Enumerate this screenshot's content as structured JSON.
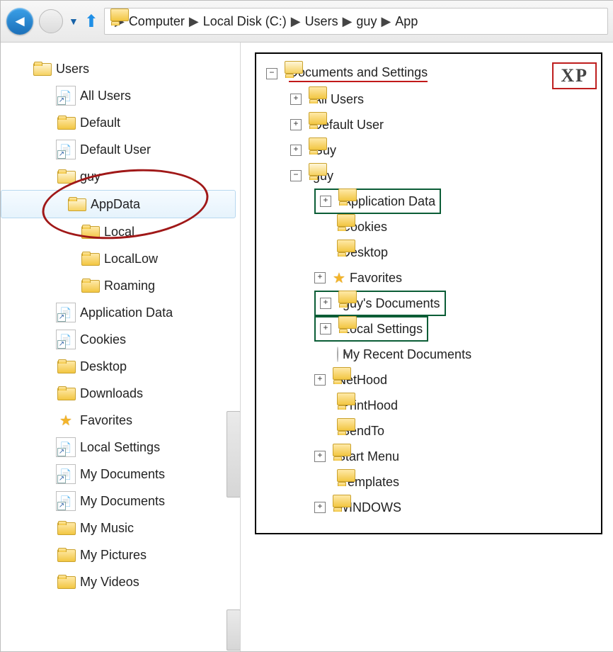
{
  "breadcrumbs": [
    "Computer",
    "Local Disk (C:)",
    "Users",
    "guy",
    "App"
  ],
  "xp_badge": "XP",
  "vista": [
    {
      "label": "Users"
    },
    {
      "label": "All Users"
    },
    {
      "label": "Default"
    },
    {
      "label": "Default User"
    },
    {
      "label": "guy"
    },
    {
      "label": "AppData"
    },
    {
      "label": "Local"
    },
    {
      "label": "LocalLow"
    },
    {
      "label": "Roaming"
    },
    {
      "label": "Application Data"
    },
    {
      "label": "Cookies"
    },
    {
      "label": "Desktop"
    },
    {
      "label": "Downloads"
    },
    {
      "label": "Favorites"
    },
    {
      "label": "Local Settings"
    },
    {
      "label": "My Documents"
    },
    {
      "label": "My Documents"
    },
    {
      "label": "My Music"
    },
    {
      "label": "My Pictures"
    },
    {
      "label": "My Videos"
    }
  ],
  "xp": [
    {
      "label": "Documents and Settings"
    },
    {
      "label": "All Users"
    },
    {
      "label": "Default User"
    },
    {
      "label": "Guy"
    },
    {
      "label": "guy"
    },
    {
      "label": "Application Data"
    },
    {
      "label": "Cookies"
    },
    {
      "label": "Desktop"
    },
    {
      "label": "Favorites"
    },
    {
      "label": "guy's Documents"
    },
    {
      "label": "Local Settings"
    },
    {
      "label": "My Recent Documents"
    },
    {
      "label": "NetHood"
    },
    {
      "label": "PrintHood"
    },
    {
      "label": "SendTo"
    },
    {
      "label": "Start Menu"
    },
    {
      "label": "Templates"
    },
    {
      "label": "WINDOWS"
    }
  ]
}
